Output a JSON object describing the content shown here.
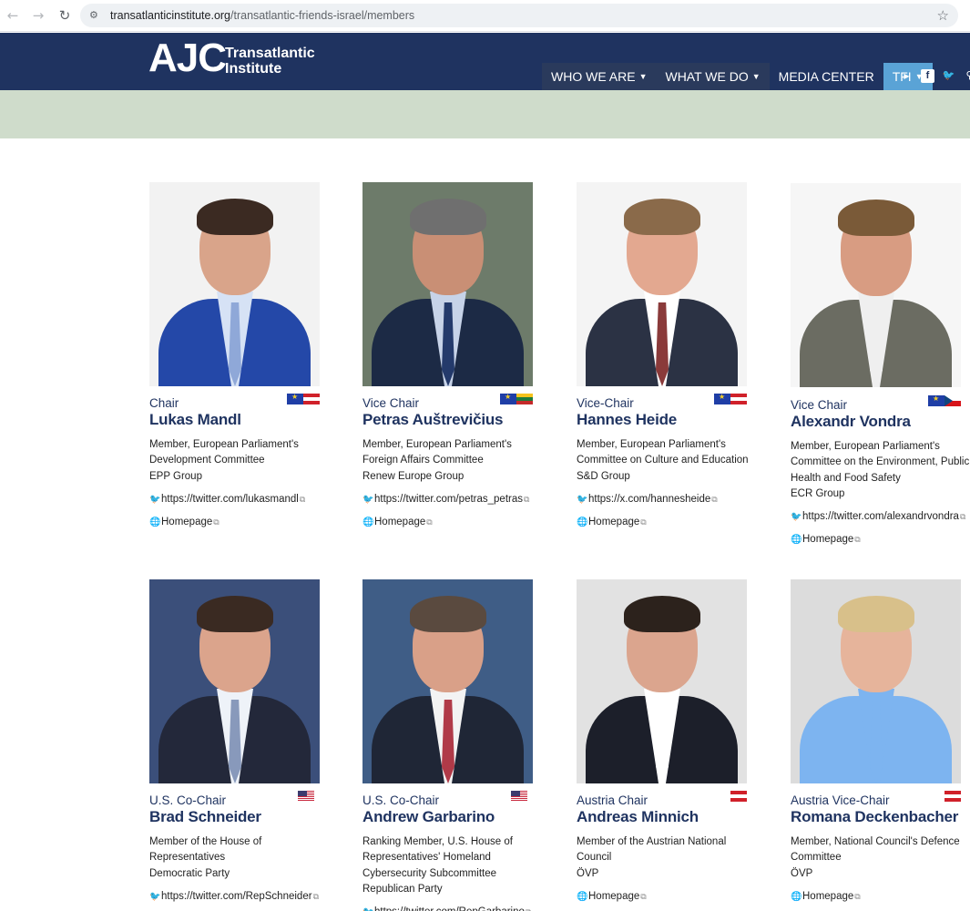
{
  "browser": {
    "url_domain": "transatlanticinstitute.org",
    "url_path": "/transatlantic-friends-israel/members"
  },
  "header": {
    "logo_main": "AJC",
    "logo_line1": "Transatlantic",
    "logo_line2": "Institute",
    "nav": [
      {
        "label": "WHO WE ARE"
      },
      {
        "label": "WHAT WE DO"
      },
      {
        "label": "MEDIA CENTER"
      },
      {
        "label": "TFI"
      }
    ],
    "social_icons": [
      "youtube-icon",
      "facebook-icon",
      "twitter-icon",
      "search-icon"
    ]
  },
  "members": [
    {
      "role": "Chair",
      "name": "Lukas Mandl",
      "flags": [
        "eu",
        "at"
      ],
      "desc": [
        "Member, European Parliament's",
        "Development Committee",
        "EPP Group"
      ],
      "twitter": "https://twitter.com/lukasmandl",
      "homepage": "Homepage"
    },
    {
      "role": "Vice Chair",
      "name": "Petras Auštrevičius",
      "flags": [
        "eu",
        "lt"
      ],
      "desc": [
        "Member, European Parliament's",
        "Foreign Affairs Committee",
        "Renew Europe Group"
      ],
      "twitter": "https://twitter.com/petras_petras",
      "homepage": "Homepage"
    },
    {
      "role": "Vice-Chair",
      "name": "Hannes Heide",
      "flags": [
        "eu",
        "at"
      ],
      "desc": [
        "Member, European Parliament's",
        "Committee on Culture and Education",
        "S&D Group"
      ],
      "twitter": "https://x.com/hannesheide",
      "homepage": "Homepage"
    },
    {
      "role": "Vice Chair",
      "name": "Alexandr Vondra",
      "flags": [
        "eu",
        "cz"
      ],
      "desc": [
        "Member, European Parliament's",
        "Committee on the Environment, Public",
        "Health and Food Safety",
        "ECR Group"
      ],
      "twitter": "https://twitter.com/alexandrvondra",
      "homepage": "Homepage"
    },
    {
      "role": "U.S. Co-Chair",
      "name": "Brad Schneider",
      "flags": [
        "us"
      ],
      "desc": [
        "Member of the House of",
        "Representatives",
        "Democratic Party"
      ],
      "twitter": "https://twitter.com/RepSchneider",
      "homepage": ""
    },
    {
      "role": "U.S. Co-Chair",
      "name": "Andrew Garbarino",
      "flags": [
        "us"
      ],
      "desc": [
        "Ranking Member, U.S. House of",
        "Representatives' Homeland",
        "Cybersecurity Subcommittee",
        "Republican Party"
      ],
      "twitter": "https://twitter.com/RepGarbarino",
      "homepage": ""
    },
    {
      "role": "Austria Chair",
      "name": "Andreas Minnich",
      "flags": [
        "at"
      ],
      "desc": [
        "Member of the Austrian National",
        "Council",
        "ÖVP"
      ],
      "twitter": "",
      "homepage": "Homepage"
    },
    {
      "role": "Austria Vice-Chair",
      "name": "Romana Deckenbacher",
      "flags": [
        "at"
      ],
      "desc": [
        "Member, National Council's Defence",
        "Committee",
        "ÖVP"
      ],
      "twitter": "",
      "homepage": "Homepage"
    }
  ]
}
